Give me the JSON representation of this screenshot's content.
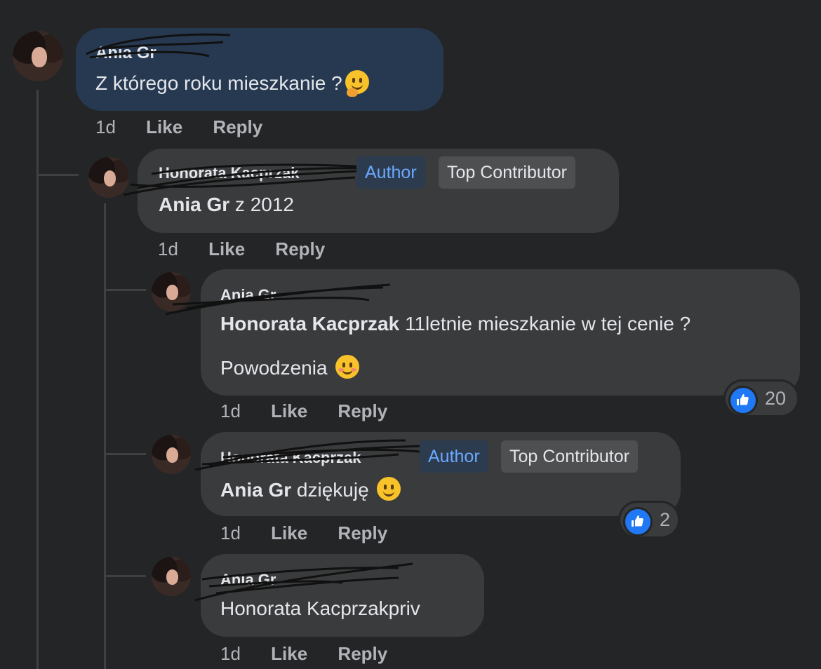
{
  "comments": [
    {
      "author": "Ania Gr",
      "text_prefix": "",
      "text": "Z którego roku mieszkanie ?",
      "emoji": "thinking-face-icon",
      "time": "1d",
      "like": "Like",
      "reply": "Reply",
      "highlighted": true
    },
    {
      "author": "Honorata Kacprzak",
      "badge_author": "Author",
      "badge_top": "Top Contributor",
      "mention": "Ania Gr",
      "text": "z 2012",
      "time": "1d",
      "like": "Like",
      "reply": "Reply"
    },
    {
      "author": "Ania Gr",
      "mention": "Honorata Kacprzak",
      "text": "11letnie mieszkanie w tej cenie ?",
      "text_line2": "Powodzenia",
      "emoji": "smiling-blush-icon",
      "time": "1d",
      "like": "Like",
      "reply": "Reply",
      "reaction_count": "20"
    },
    {
      "author": "Honorata Kacprzak",
      "badge_author": "Author",
      "badge_top": "Top Contributor",
      "mention": "Ania Gr",
      "text": "dziękuję",
      "emoji": "slightly-smiling-icon",
      "time": "1d",
      "like": "Like",
      "reply": "Reply",
      "reaction_count": "2"
    },
    {
      "author": "Ania Gr",
      "text": "Honorata Kacprzakpriv",
      "time": "1d",
      "like": "Like",
      "reply": "Reply"
    }
  ],
  "colors": {
    "background": "#242526",
    "bubble": "#3a3b3c",
    "highlight_bubble": "#263951",
    "author_badge_text": "#6aa9ff",
    "like_blue": "#2078f4"
  }
}
